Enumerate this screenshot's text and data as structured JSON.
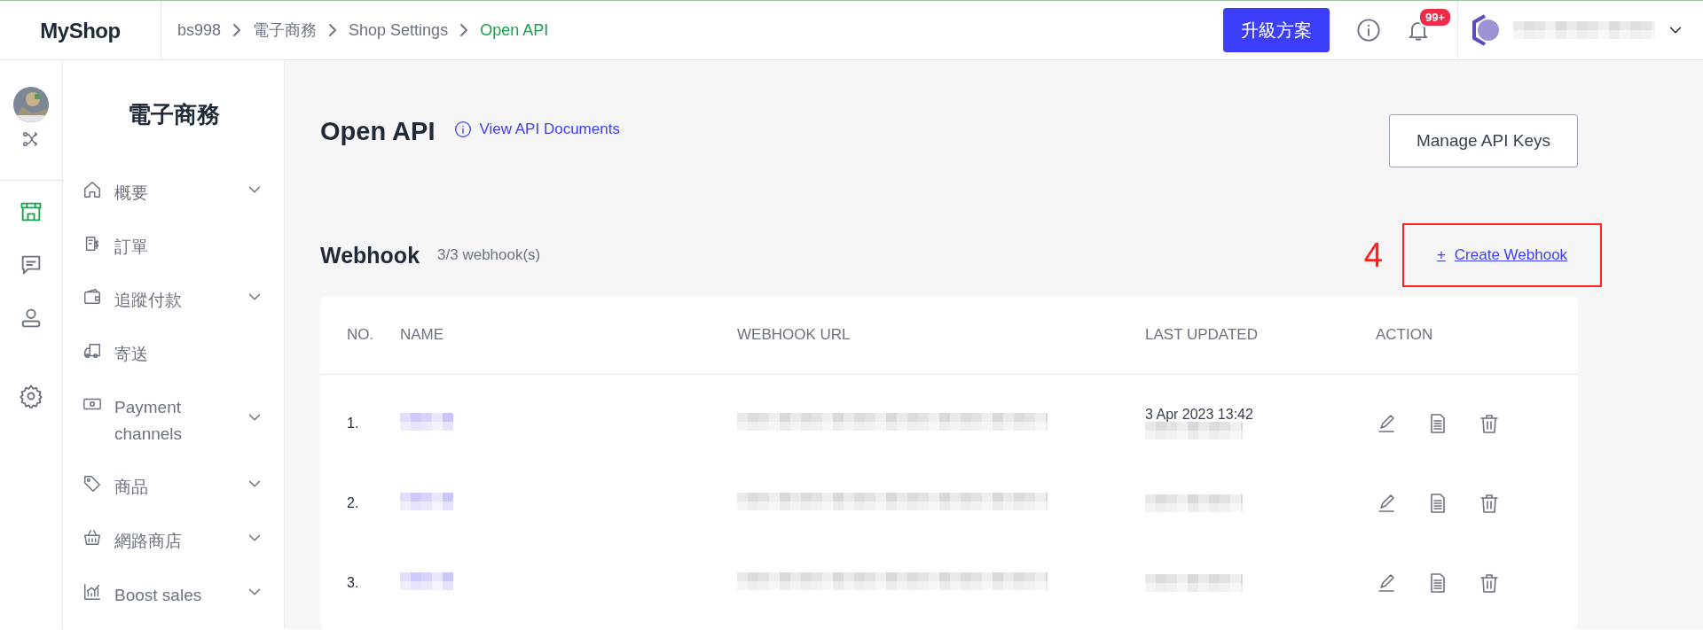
{
  "header": {
    "logo": "MyShop",
    "breadcrumbs": [
      {
        "label": "bs998",
        "selected": false
      },
      {
        "label": "電子商務",
        "selected": false
      },
      {
        "label": "Shop Settings",
        "selected": false
      },
      {
        "label": "Open API",
        "selected": true
      }
    ],
    "upgrade_button": "升級方案",
    "notification_badge": "99+"
  },
  "rail": {
    "items": [
      {
        "selected": true
      },
      {
        "selected": false
      },
      {
        "selected": false
      },
      {
        "selected": false
      }
    ]
  },
  "sidebar": {
    "title": "電子商務",
    "items": [
      {
        "label": "概要",
        "has_submenu": true
      },
      {
        "label": "訂單",
        "has_submenu": false
      },
      {
        "label": "追蹤付款",
        "has_submenu": true
      },
      {
        "label": "寄送",
        "has_submenu": false
      },
      {
        "label": "Payment channels",
        "has_submenu": true
      },
      {
        "label": "商品",
        "has_submenu": true
      },
      {
        "label": "網路商店",
        "has_submenu": true
      },
      {
        "label": "Boost sales",
        "has_submenu": true
      }
    ]
  },
  "page": {
    "title": "Open API",
    "docs_link": "View API Documents",
    "manage_button": "Manage API Keys"
  },
  "webhook": {
    "title": "Webhook",
    "count": "3/3 webhook(s)",
    "annotation": "4",
    "create_link": "Create Webhook",
    "create_icon": "+"
  },
  "table": {
    "columns": [
      "NO.",
      "NAME",
      "WEBHOOK URL",
      "LAST UPDATED",
      "ACTION"
    ],
    "rows": [
      {
        "no": "1.",
        "last_updated": "3 Apr 2023 13:42"
      },
      {
        "no": "2."
      },
      {
        "no": "3."
      }
    ]
  }
}
